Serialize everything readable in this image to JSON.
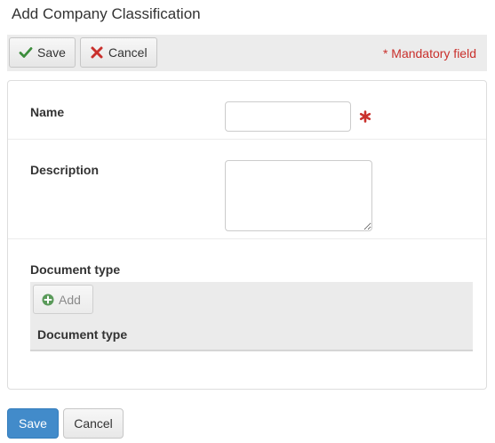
{
  "page": {
    "title": "Add Company Classification"
  },
  "toolbar": {
    "save_label": "Save",
    "save_icon": "check-icon",
    "cancel_label": "Cancel",
    "cancel_icon": "x-icon",
    "mandatory_note": "* Mandatory field"
  },
  "form": {
    "name": {
      "label": "Name",
      "value": "",
      "required": true,
      "required_icon": "asterisk-icon"
    },
    "description": {
      "label": "Description",
      "value": ""
    },
    "document_type": {
      "label": "Document type",
      "add_label": "Add",
      "add_icon": "plus-circle-icon",
      "columns": [
        "Document type"
      ],
      "rows": []
    }
  },
  "footer": {
    "save_label": "Save",
    "cancel_label": "Cancel"
  },
  "colors": {
    "primary": "#428bca",
    "mandatory": "#c9302c",
    "check_green": "#3c8d3c",
    "cross_red": "#c9302c",
    "add_green": "#5a9a5a"
  }
}
